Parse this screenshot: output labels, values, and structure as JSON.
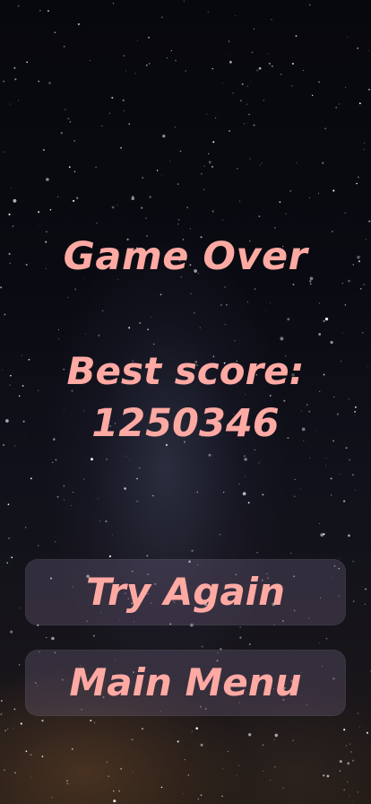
{
  "screen": {
    "title": "Game Over",
    "best_score_label": "Best score:",
    "best_score_value": "1250346"
  },
  "buttons": {
    "try_again": "Try Again",
    "main_menu": "Main Menu"
  },
  "style": {
    "text_color": "#ffa9a3",
    "button_background": "rgba(122,106,138,0.30)"
  }
}
